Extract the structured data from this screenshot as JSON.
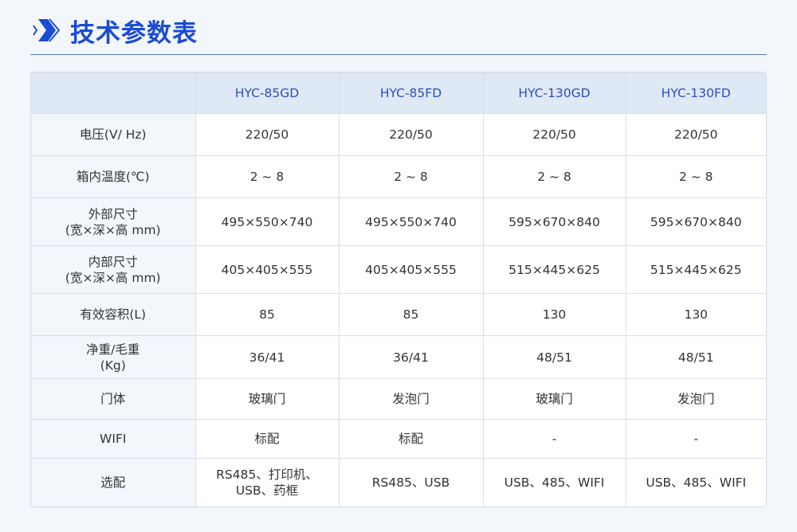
{
  "page": {
    "title": "技术参数表",
    "colors": {
      "accent": "#1a4bd6",
      "header_bg": "#dfe8f5",
      "label_bg": "#f3f6fb"
    }
  },
  "table": {
    "columns": [
      "",
      "HYC-85GD",
      "HYC-85FD",
      "HYC-130GD",
      "HYC-130FD"
    ],
    "rows": [
      {
        "label": [
          "电压(V/ Hz)"
        ],
        "values": [
          "220/50",
          "220/50",
          "220/50",
          "220/50"
        ]
      },
      {
        "label": [
          "箱内温度(℃)"
        ],
        "values": [
          "2 ~ 8",
          "2 ~ 8",
          "2 ~ 8",
          "2 ~ 8"
        ]
      },
      {
        "label": [
          "外部尺寸",
          "(宽×深×高 mm)"
        ],
        "values": [
          "495×550×740",
          "495×550×740",
          "595×670×840",
          "595×670×840"
        ]
      },
      {
        "label": [
          "内部尺寸",
          "(宽×深×高 mm)"
        ],
        "values": [
          "405×405×555",
          "405×405×555",
          "515×445×625",
          "515×445×625"
        ]
      },
      {
        "label": [
          "有效容积(L)"
        ],
        "values": [
          "85",
          "85",
          "130",
          "130"
        ]
      },
      {
        "label": [
          "净重/毛重",
          "(Kg)"
        ],
        "values": [
          "36/41",
          "36/41",
          "48/51",
          "48/51"
        ]
      },
      {
        "label": [
          "门体"
        ],
        "values": [
          "玻璃门",
          "发泡门",
          "玻璃门",
          "发泡门"
        ]
      },
      {
        "label": [
          "WIFI"
        ],
        "values": [
          "标配",
          "标配",
          "-",
          "-"
        ]
      },
      {
        "label": [
          "选配"
        ],
        "values": [
          [
            "RS485、打印机、",
            "USB、药框"
          ],
          [
            "RS485、USB"
          ],
          [
            "USB、485、WIFI"
          ],
          [
            "USB、485、WIFI"
          ]
        ]
      }
    ]
  }
}
